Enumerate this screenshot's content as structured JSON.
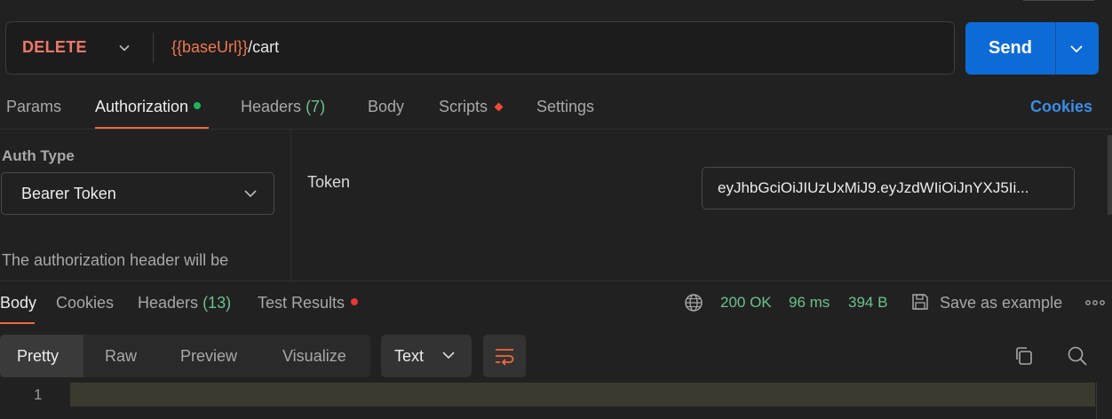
{
  "request": {
    "method": "DELETE",
    "url_var": "{{baseUrl}}",
    "url_path": "/cart",
    "send_label": "Send"
  },
  "request_tabs": {
    "params": "Params",
    "authorization": "Authorization",
    "headers": "Headers",
    "headers_count": "(7)",
    "body": "Body",
    "scripts": "Scripts",
    "settings": "Settings",
    "cookies": "Cookies"
  },
  "auth": {
    "type_label": "Auth Type",
    "type_value": "Bearer Token",
    "help_text": "The authorization header will be",
    "token_label": "Token",
    "token_value": "eyJhbGciOiJIUzUxMiJ9.eyJzdWIiOiJnYXJ5Ii..."
  },
  "response_tabs": {
    "body": "Body",
    "cookies": "Cookies",
    "headers": "Headers",
    "headers_count": "(13)",
    "test_results": "Test Results"
  },
  "response_status": {
    "status": "200 OK",
    "time": "96 ms",
    "size": "394 B",
    "save_label": "Save as example"
  },
  "format_bar": {
    "pretty": "Pretty",
    "raw": "Raw",
    "preview": "Preview",
    "visualize": "Visualize",
    "text_select": "Text"
  },
  "editor": {
    "line_numbers": [
      "1"
    ]
  },
  "colors": {
    "accent_orange": "#ef6a3a",
    "send_blue": "#0d6bd8",
    "method_delete": "#f0786b",
    "status_green": "#6cc28a",
    "link_blue": "#3b8de6"
  }
}
